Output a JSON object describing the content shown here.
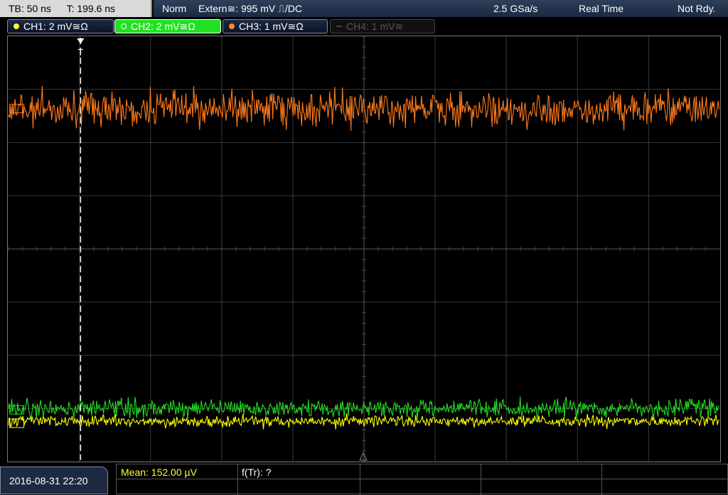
{
  "timebase": {
    "tb": "TB: 50 ns",
    "t": "T: 199.6 ns"
  },
  "topbar": {
    "mode": "Norm",
    "trigger": "Extern≅: 995 mV ⎍/DC",
    "samplerate": "2.5 GSa/s",
    "acq": "Real Time",
    "status": "Not Rdy."
  },
  "channels": [
    {
      "label": "CH1: 2 mV≅Ω",
      "color": "#ffff33"
    },
    {
      "label": "CH2: 2 mV≅Ω",
      "color": "#22e122"
    },
    {
      "label": "CH3: 1 mV≅Ω",
      "color": "#ff8a2a"
    },
    {
      "label": "CH4: 1 mV≅",
      "color": "#555555"
    }
  ],
  "markers": {
    "trigger_marker": "T"
  },
  "footer": {
    "datetime": "2016-08-31 22:20",
    "mean": "Mean: 152.00 µV",
    "ftr": "f(Tr): ?"
  },
  "colors": {
    "ch1": "#ffff00",
    "ch2": "#22dd22",
    "ch3": "#ff7a1a",
    "grid": "#4a4a4a"
  }
}
